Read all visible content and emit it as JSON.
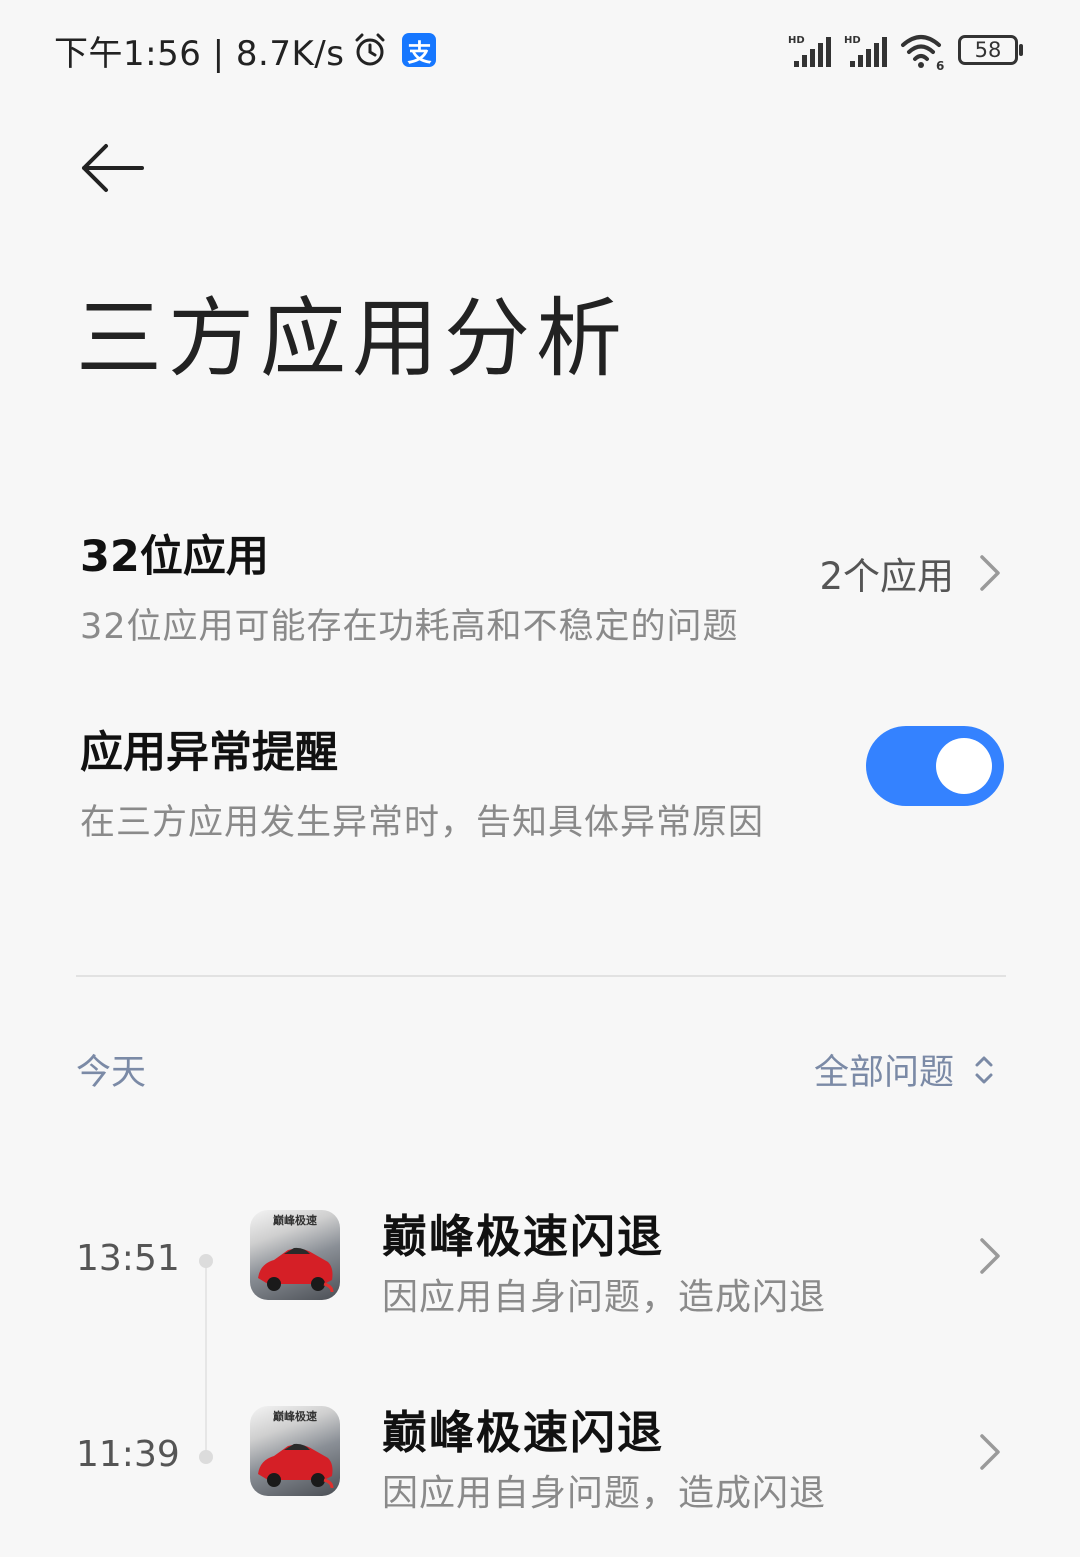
{
  "status_bar": {
    "time_and_speed": "下午1:56 | 8.7K/s",
    "alipay_glyph": "支",
    "battery_level": "58",
    "icons": [
      "alarm-icon",
      "alipay-icon",
      "hd-signal-icon",
      "hd-signal-icon",
      "wifi6-icon",
      "battery-icon"
    ]
  },
  "header": {
    "title": "三方应用分析"
  },
  "settings": {
    "app32": {
      "title": "32位应用",
      "description": "32位应用可能存在功耗高和不稳定的问题",
      "value": "2个应用"
    },
    "anomaly_alert": {
      "title": "应用异常提醒",
      "description": "在三方应用发生异常时，告知具体异常原因",
      "enabled": true
    }
  },
  "issues": {
    "section_label": "今天",
    "filter_label": "全部问题",
    "events": [
      {
        "time": "13:51",
        "app_icon_text": "巅峰极速",
        "title": "巅峰极速闪退",
        "description": "因应用自身问题，造成闪退"
      },
      {
        "time": "11:39",
        "app_icon_text": "巅峰极速",
        "title": "巅峰极速闪退",
        "description": "因应用自身问题，造成闪退"
      }
    ]
  },
  "colors": {
    "accent": "#3482ff",
    "background": "#f7f7f7",
    "secondary_text": "#8a8a8a",
    "section_label": "#7b8aa6"
  }
}
